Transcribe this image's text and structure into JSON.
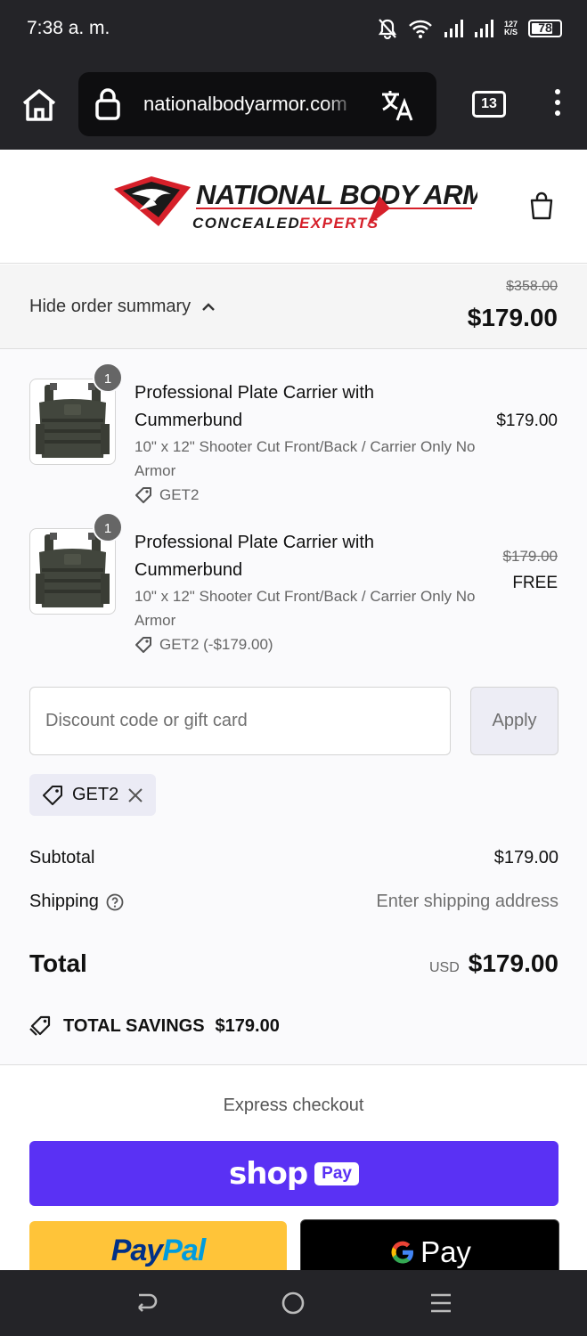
{
  "status_bar": {
    "time": "7:38 a. m.",
    "net_speed_top": "127",
    "net_speed_bottom": "K/S",
    "battery": "78",
    "battery_fraction": 0.78
  },
  "browser": {
    "url": "nationalbodyarmor.com",
    "tab_count": "13"
  },
  "header": {
    "logo_line1": "NATIONAL BODY ARMOR",
    "logo_line2_a": "CONCEALED",
    "logo_line2_b": "EXPERTS",
    "cart_icon": "shopping-bag-icon"
  },
  "summary": {
    "toggle_label": "Hide order summary",
    "compare_total": "$358.00",
    "total": "$179.00"
  },
  "items": [
    {
      "qty": "1",
      "title": "Professional Plate Carrier with Cummerbund",
      "variant": "10\" x 12\" Shooter Cut Front/Back / Carrier Only No Armor",
      "discount": "GET2",
      "price": "$179.00"
    },
    {
      "qty": "1",
      "title": "Professional Plate Carrier with Cummerbund",
      "variant": "10\" x 12\" Shooter Cut Front/Back / Carrier Only No Armor",
      "discount": "GET2 (-$179.00)",
      "compare_price": "$179.00",
      "price": "FREE"
    }
  ],
  "discount": {
    "placeholder": "Discount code or gift card",
    "apply_label": "Apply",
    "applied_code": "GET2"
  },
  "totals": {
    "subtotal_label": "Subtotal",
    "subtotal": "$179.00",
    "shipping_label": "Shipping",
    "shipping_value": "Enter shipping address",
    "total_label": "Total",
    "currency": "USD",
    "total": "$179.00",
    "savings_label": "TOTAL SAVINGS",
    "savings": "$179.00"
  },
  "express": {
    "label": "Express checkout",
    "shop_word": "shop",
    "shop_pay_chip": "Pay",
    "paypal_a": "Pay",
    "paypal_b": "Pal",
    "gpay_text": "Pay"
  },
  "colors": {
    "shop_pay": "#5a31f4",
    "paypal": "#ffc439",
    "brand_red": "#d6202a"
  }
}
